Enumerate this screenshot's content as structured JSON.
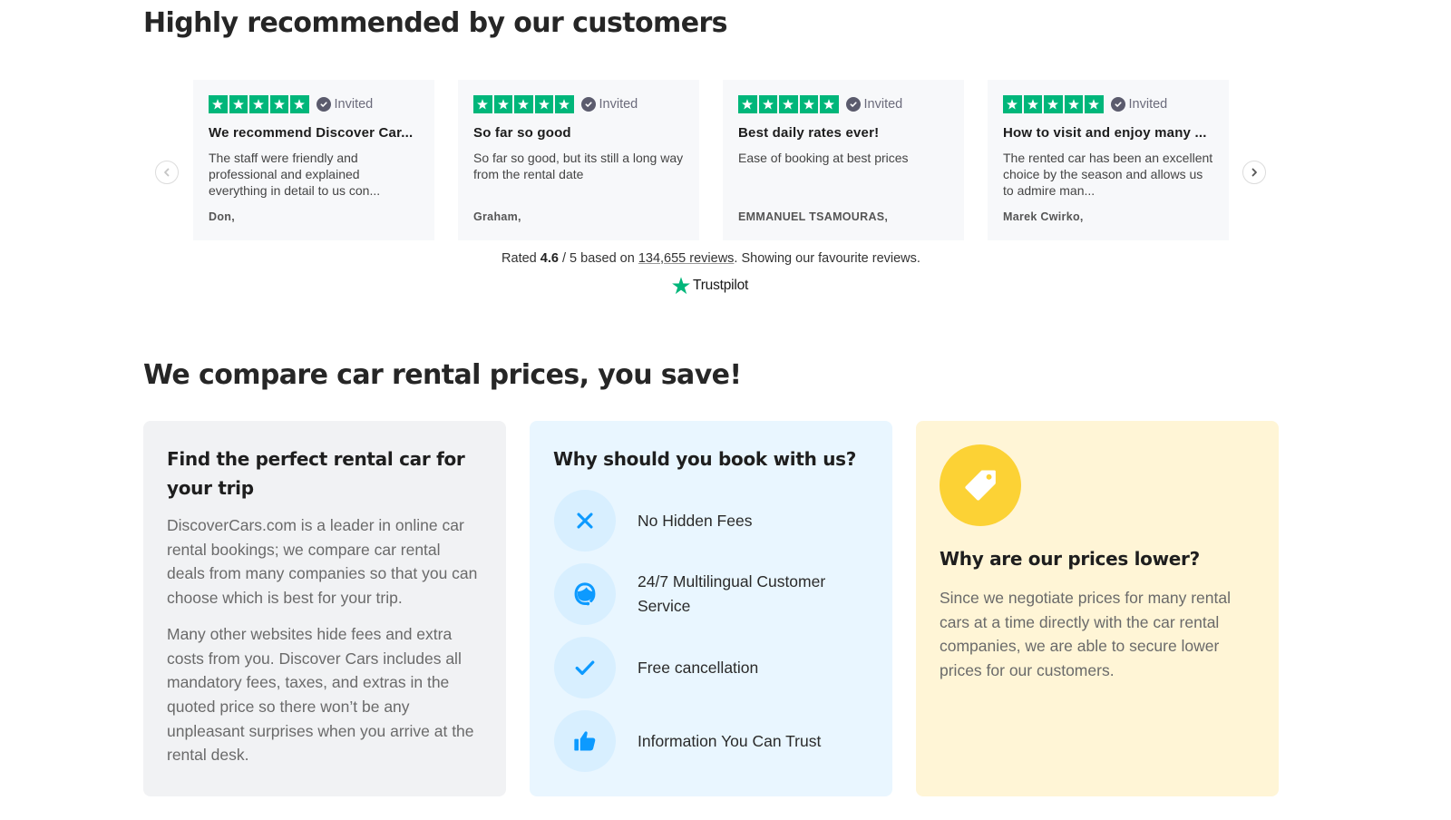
{
  "reviews_section": {
    "title": "Highly recommended by our customers",
    "invited_label": "Invited",
    "star_count": 5,
    "brand_color": "#00b67a",
    "reviews": [
      {
        "title": "We recommend Discover Car...",
        "body": "The staff were friendly and professional and explained everything in detail to us con...",
        "author": "Don,"
      },
      {
        "title": "So far so good",
        "body": "So far so good, but its still a long way from the rental date",
        "author": "Graham,"
      },
      {
        "title": "Best daily rates ever!",
        "body": "Ease of booking at best prices",
        "author": "EMMANUEL TSAMOURAS,"
      },
      {
        "title": "How to visit and enjoy many ...",
        "body": "The rented car has been an excellent choice by the season and allows us to admire man...",
        "author": "Marek Cwirko,"
      }
    ],
    "prev_icon": "chevron-left-icon",
    "next_icon": "chevron-right-icon",
    "rating": {
      "prefix": "Rated ",
      "score": "4.6",
      "scale": " / 5 based on ",
      "count_link": "134,655 reviews",
      "suffix": ". Showing our favourite reviews."
    },
    "trustpilot_label": "Trustpilot"
  },
  "compare_section": {
    "title": "We compare car rental prices, you save!",
    "card_find": {
      "title": "Find the perfect rental car for your trip",
      "paragraphs": [
        "DiscoverCars.com is a leader in online car rental bookings; we compare car rental deals from many companies so that you can choose which is best for your trip.",
        "Many other websites hide fees and extra costs from you. Discover Cars includes all mandatory fees, taxes, and extras in the quoted price so there won’t be any unpleasant surprises when you arrive at the rental desk."
      ]
    },
    "card_why": {
      "title": "Why should you book with us?",
      "accent_color": "#0d9aff",
      "features": [
        {
          "icon": "x-icon",
          "label": "No Hidden Fees"
        },
        {
          "icon": "headset-icon",
          "label": "24/7 Multilingual Customer Service"
        },
        {
          "icon": "checkmark-icon",
          "label": "Free cancellation"
        },
        {
          "icon": "thumbs-up-icon",
          "label": "Information You Can Trust"
        }
      ]
    },
    "card_lower": {
      "icon": "price-tag-icon",
      "accent_color": "#fcd235",
      "title": "Why are our prices lower?",
      "body": "Since we negotiate prices for many rental cars at a time directly with the car rental companies, we are able to secure lower prices for our customers."
    }
  }
}
